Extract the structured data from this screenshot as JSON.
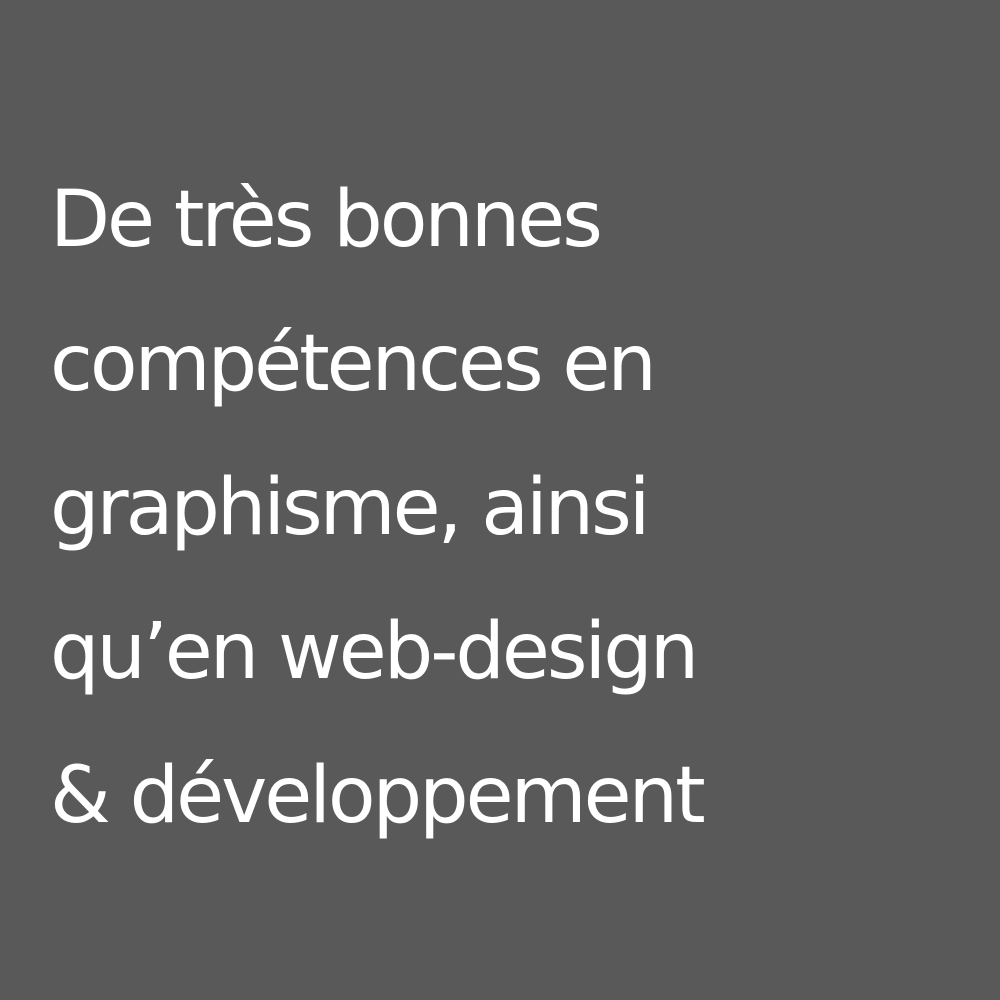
{
  "colors": {
    "background": "#595959",
    "text": "#ffffff"
  },
  "text": {
    "lines": [
      "De très bonnes",
      "compétences en",
      "graphisme, ainsi",
      "qu’en  web-design",
      "& développement"
    ]
  }
}
